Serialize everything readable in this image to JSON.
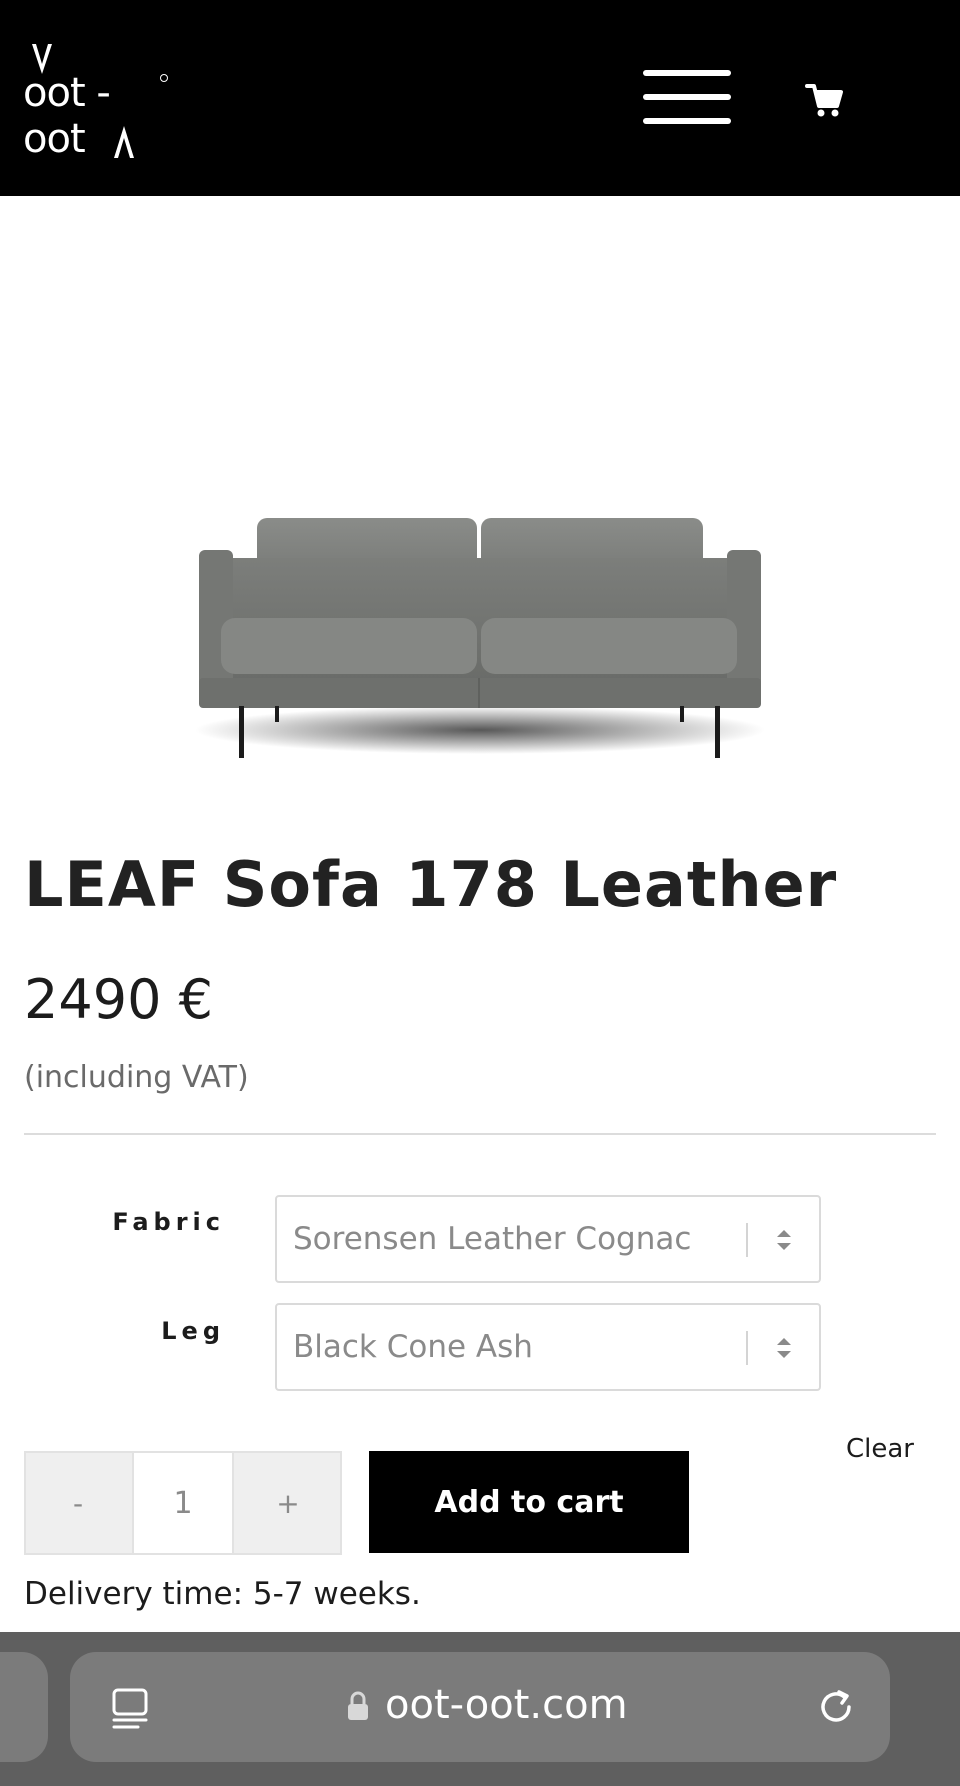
{
  "header": {
    "logo_text": "oot - oot",
    "menu_icon": "hamburger-menu-icon",
    "cart_icon": "shopping-cart-icon",
    "background": "#000000"
  },
  "product": {
    "image": "grey-leather-sofa",
    "title": "LEAF Sofa 178 Leather",
    "price": "2490 €",
    "vat_note": "(including VAT)"
  },
  "variations": {
    "fabric": {
      "label": "Fabric",
      "value": "Sorensen Leather Cognac"
    },
    "leg": {
      "label": "Leg",
      "value": "Black Cone Ash"
    },
    "clear_label": "Clear"
  },
  "purchase": {
    "minus_label": "-",
    "quantity": "1",
    "plus_label": "+",
    "add_to_cart_label": "Add to cart",
    "accent": "#000000"
  },
  "delivery": {
    "text": "Delivery time: 5-7 weeks."
  },
  "browser": {
    "url": "oot-oot.com",
    "reader_icon": "reader-mode-icon",
    "lock_icon": "lock-icon",
    "reload_icon": "reload-icon"
  }
}
